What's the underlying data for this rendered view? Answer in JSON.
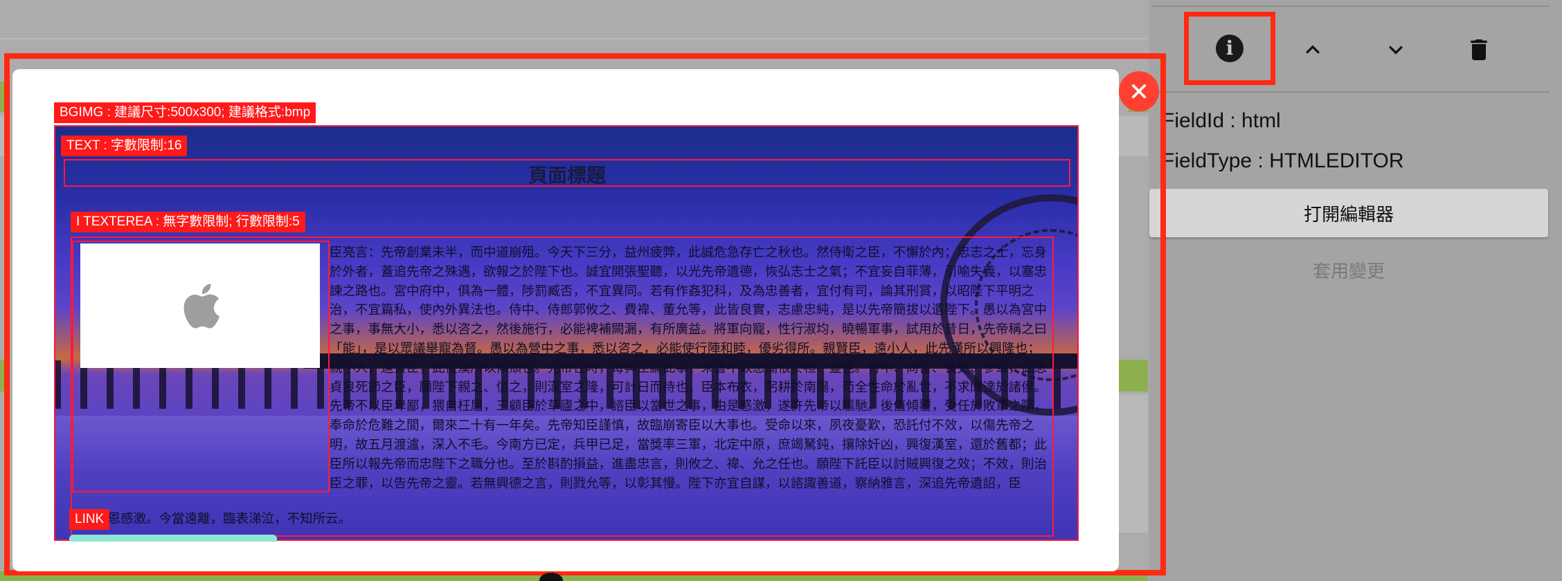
{
  "background_page": {},
  "right_panel": {
    "toolbar": {
      "info_icon": "info-icon",
      "move_up_icon": "chevron-up-icon",
      "move_down_icon": "chevron-down-icon",
      "delete_icon": "trash-icon"
    },
    "field_id_line": "FieldId : html",
    "field_type_line": "FieldType : HTMLEDITOR",
    "open_editor_label": "打開編輯器",
    "apply_changes_label": "套用變更"
  },
  "modal": {
    "close_icon": "close-icon",
    "tags": {
      "bgimg": "BGIMG : 建議尺寸:500x300; 建議格式:bmp",
      "text": "TEXT : 字數限制:16",
      "texterea": "I TEXTEREA : 無字數限制; 行數限制:5",
      "link": "LINK"
    },
    "page_title": "頁面標題",
    "image_icon": "apple-logo-icon",
    "article_body": "臣亮言：先帝創業未半，而中道崩殂。今天下三分，益州疲弊，此誠危急存亡之秋也。然侍衛之臣，不懈於內；忠志之士，忘身於外者，蓋追先帝之殊遇，欲報之於陛下也。誠宜開張聖聽，以光先帝遺德，恢弘志士之氣；不宜妄自菲薄，引喻失義，以塞忠諫之路也。宮中府中，俱為一體，陟罰臧否，不宜異同。若有作姦犯科，及為忠善者，宜付有司，論其刑賞，以昭陛下平明之治，不宜篇私，使內外異法也。侍中、侍郎郭攸之、費禕、董允等，此皆良實，志慮忠純，是以先帝簡拔以遺陛下。愚以為宮中之事，事無大小，悉以咨之，然後施行，必能裨補闕漏，有所廣益。將軍向寵，性行淑均，曉暢軍事，試用於昔日，先帝稱之曰「能」，是以眾議舉寵為督。愚以為營中之事，悉以咨之，必能使行陣和睦，優劣得所。親賢臣，遠小人，此先漢所以興隆也；親小人，遠賢臣，此後漢所以傾頹也。先帝在時，每與臣論此事，未嘗不歎息痛恨於桓、靈也。侍中、尚書、長史、參軍，此悉貞良死節之臣，願陛下親之、信之，則漢室之隆，可計日而待也。臣本布衣，躬耕於南陽，苟全性命於亂世，不求聞達於諸侯。先帝不以臣卑鄙，猥自枉屈，三顧臣於草廬之中，諮臣以當世之事，由是感激，遂許先帝以驅馳。後值傾覆，受任於敗軍之際，奉命於危難之間，爾來二十有一年矣。先帝知臣謹慎，故臨崩寄臣以大事也。受命以來，夙夜憂歎，恐託付不效，以傷先帝之明，故五月渡瀘，深入不毛。今南方已定，兵甲已足，當獎率三軍，北定中原，庶竭駑鈍，攘除奸凶，興復漢室，還於舊都；此臣所以報先帝而忠陛下之職分也。至於斟酌損益，進盡忠言，則攸之、禕、允之任也。願陛下託臣以討賊興復之效；不效，則治臣之罪，以告先帝之靈。若無興德之言，則戮允等，以彰其慢。陛下亦宜自謀，以諮諏善道，察納雅言，深追先帝遺詔，臣",
    "article_tail": "不勝受恩感激。今當遠離，臨表涕泣，不知所云。"
  }
}
